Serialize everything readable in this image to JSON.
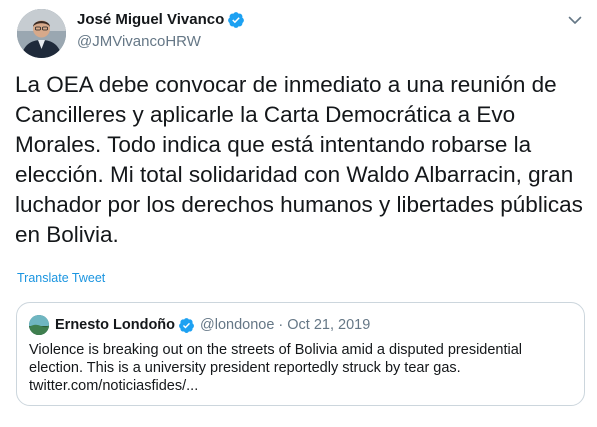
{
  "tweet": {
    "author": {
      "display_name": "José Miguel Vivanco",
      "handle": "@JMVivancoHRW",
      "verified": true
    },
    "text": "La OEA debe convocar de inmediato a una reunión de Cancilleres y aplicarle la Carta Democrática a Evo Morales. Todo indica que está intentando robarse la elección. Mi total solidaridad con Waldo Albarracin, gran luchador por los derechos humanos y libertades públicas en Bolivia.",
    "translate_label": "Translate Tweet"
  },
  "quoted_tweet": {
    "author": {
      "display_name": "Ernesto Londoño",
      "handle": "@londonoe",
      "verified": true
    },
    "separator": "·",
    "date": "Oct 21, 2019",
    "lines": [
      "Violence is breaking out on the streets of Bolivia amid a disputed presidential",
      "election. This is a university president reportedly struck by tear gas.",
      "twitter.com/noticiasfides/..."
    ]
  },
  "icons": {
    "verified": "verified-badge-icon",
    "menu": "chevron-down-icon"
  },
  "colors": {
    "text": "#14171a",
    "secondary": "#657786",
    "link": "#1b95e0",
    "verified": "#1da1f2",
    "border": "#ccd6dd"
  }
}
